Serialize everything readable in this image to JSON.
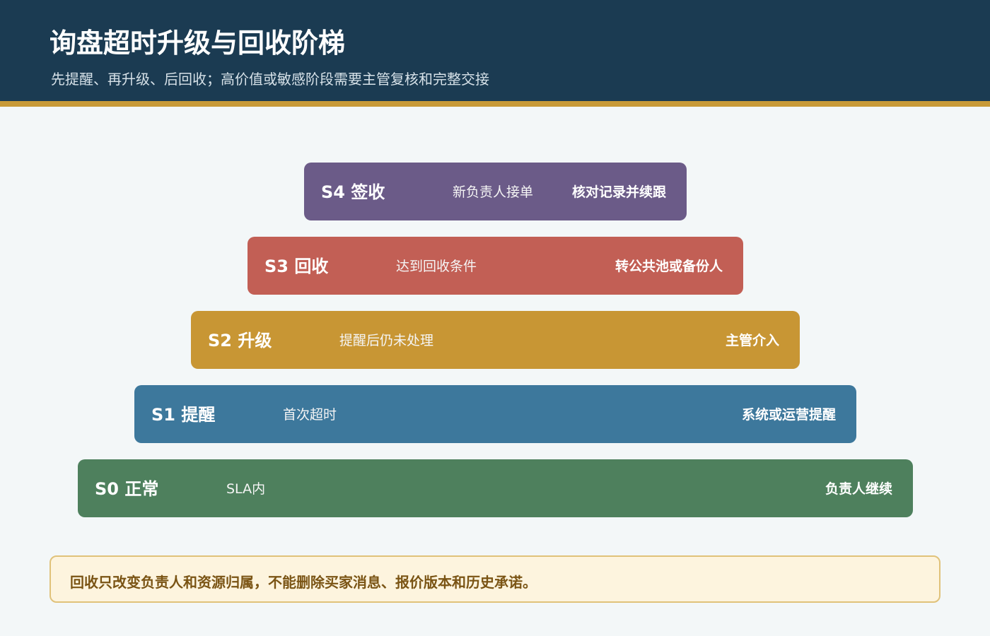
{
  "header": {
    "title": "询盘超时升级与回收阶梯",
    "subtitle": "先提醒、再升级、后回收；高价值或敏感阶段需要主管复核和完整交接"
  },
  "tiers": [
    {
      "name": "S4 签收",
      "trigger": "新负责人接单",
      "action": "核对记录并续跟",
      "color": "#6b5b88"
    },
    {
      "name": "S3 回收",
      "trigger": "达到回收条件",
      "action": "转公共池或备份人",
      "color": "#c25f55"
    },
    {
      "name": "S2 升级",
      "trigger": "提醒后仍未处理",
      "action": "主管介入",
      "color": "#c89634"
    },
    {
      "name": "S1 提醒",
      "trigger": "首次超时",
      "action": "系统或运营提醒",
      "color": "#3d789c"
    },
    {
      "name": "S0 正常",
      "trigger": "SLA内",
      "action": "负责人继续",
      "color": "#4e805d"
    }
  ],
  "note": {
    "text": "回收只改变负责人和资源归属，不能删除买家消息、报价版本和历史承诺。"
  }
}
